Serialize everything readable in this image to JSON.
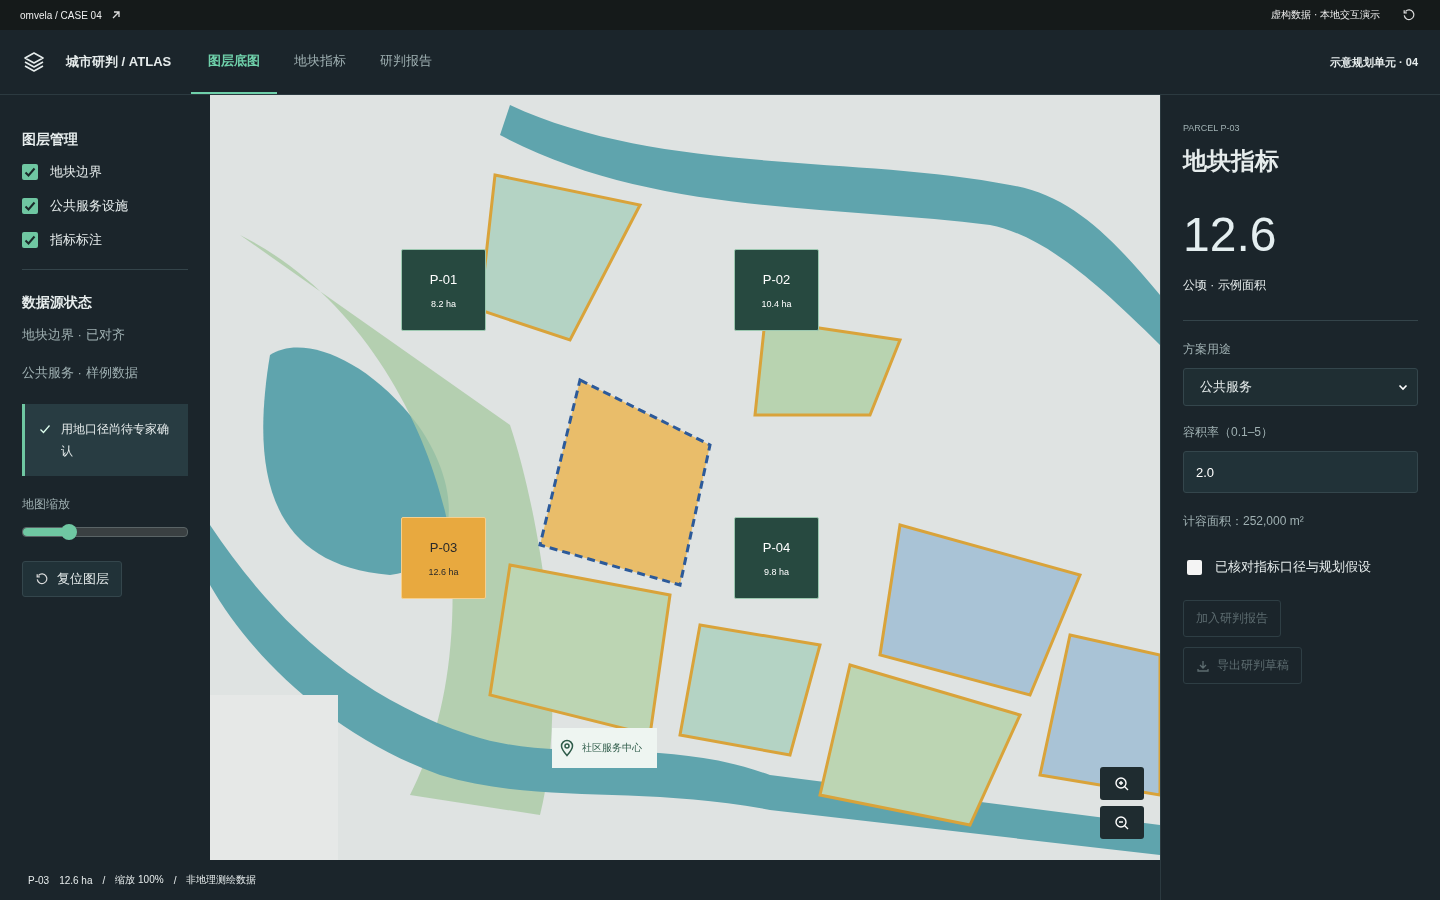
{
  "top_bar": {
    "breadcrumb": "omvela / CASE 04",
    "notice": "虚构数据 · 本地交互演示"
  },
  "header": {
    "title": "城市研判 / ATLAS",
    "unit": "示意规划单元 · 04"
  },
  "tabs": [
    {
      "label": "图层底图",
      "selected": true
    },
    {
      "label": "地块指标",
      "selected": false
    },
    {
      "label": "研判报告",
      "selected": false
    }
  ],
  "sidebar": {
    "layers_title": "图层管理",
    "layers": [
      {
        "label": "地块边界",
        "checked": true
      },
      {
        "label": "公共服务设施",
        "checked": true
      },
      {
        "label": "指标标注",
        "checked": true
      }
    ],
    "sources_title": "数据源状态",
    "sources": [
      "地块边界 · 已对齐",
      "公共服务 · 样例数据"
    ],
    "notice": "用地口径尚待专家确认",
    "zoom_label": "地图缩放",
    "zoom": {
      "level": 0.28
    },
    "reset_button": "复位图层"
  },
  "map": {
    "parcels": [
      {
        "name": "P-01",
        "area": "8.2 ha",
        "selected": false
      },
      {
        "name": "P-02",
        "area": "10.4 ha",
        "selected": false
      },
      {
        "name": "P-03",
        "area": "12.6 ha",
        "selected": true
      },
      {
        "name": "P-04",
        "area": "9.8 ha",
        "selected": false
      }
    ],
    "pin_label": "社区服务中心"
  },
  "status_bar": [
    "P-03",
    "12.6 ha",
    "/",
    "缩放 100%",
    "/",
    "非地理测绘数据"
  ],
  "detail": {
    "eyebrow": "PARCEL P-03",
    "title": "地块指标",
    "value": "12.6",
    "unit": "公顷 · 示例面积",
    "use_label": "方案用途",
    "use_value": "公共服务",
    "far_label": "容积率（0.1–5）",
    "far_value": "2.0",
    "gfa": "计容面积：252,000 m²",
    "confirm": {
      "label": "已核对指标口径与规划假设",
      "checked": false
    },
    "buttons": [
      {
        "label": "加入研判报告",
        "disabled": true,
        "kind": "plain"
      },
      {
        "label": "导出研判草稿",
        "disabled": true,
        "kind": "download"
      }
    ]
  }
}
